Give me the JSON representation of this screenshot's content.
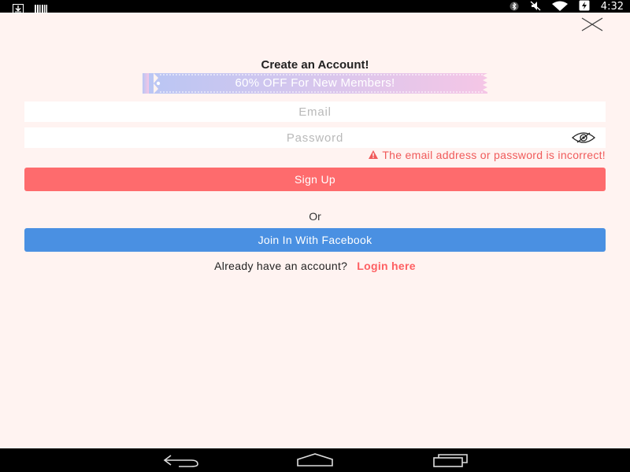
{
  "status_bar": {
    "time": "4:32",
    "left_icons": [
      "download-icon",
      "barcode-icon"
    ],
    "right_icons": [
      "bluetooth-icon",
      "mute-icon",
      "wifi-icon",
      "battery-charging-icon"
    ]
  },
  "dialog": {
    "title": "Create an Account!",
    "promo_banner": "60% OFF For New Members!",
    "email": {
      "placeholder": "Email",
      "value": ""
    },
    "password": {
      "placeholder": "Password",
      "value": ""
    },
    "error_message": "The email address or password is incorrect!",
    "signup_label": "Sign Up",
    "or_label": "Or",
    "facebook_label": "Join In With Facebook",
    "already_text": "Already have an account?",
    "login_link": "Login here"
  },
  "colors": {
    "background": "#fff3f1",
    "signup_button": "#fe6b6d",
    "facebook_button": "#4a90e2",
    "error_text": "#f05a5a",
    "login_link": "#fe5f62",
    "banner_gradient_start": "#b9c6f4",
    "banner_gradient_end": "#f5c6e6"
  },
  "nav_bar": {
    "icons": [
      "back-icon",
      "home-icon",
      "recent-apps-icon"
    ]
  }
}
